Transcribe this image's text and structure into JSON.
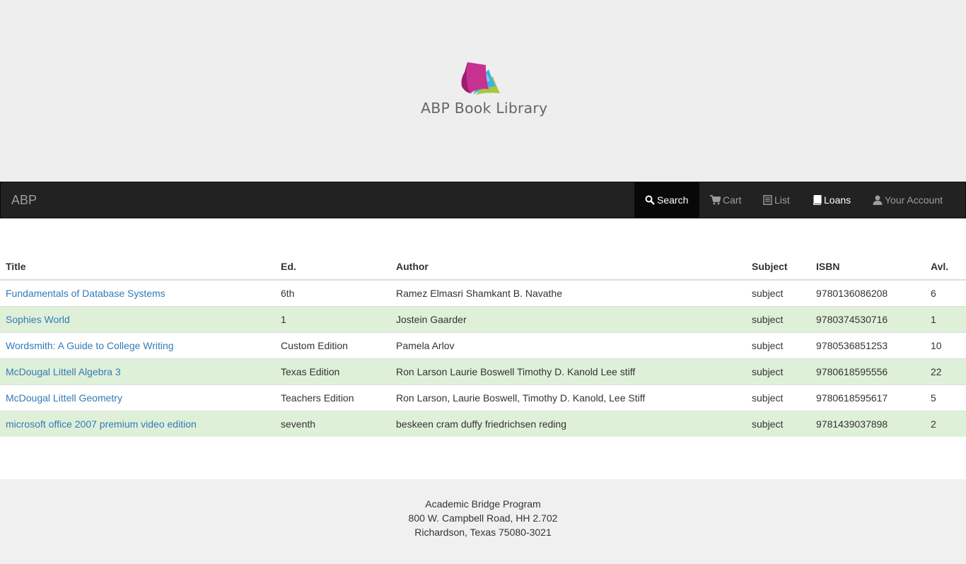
{
  "header": {
    "logo_text": "ABP Book Library"
  },
  "navbar": {
    "brand": "ABP",
    "items": [
      {
        "label": "Search",
        "icon": "search-icon",
        "active": true
      },
      {
        "label": "Cart",
        "icon": "cart-icon"
      },
      {
        "label": "List",
        "icon": "list-icon"
      },
      {
        "label": "Loans",
        "icon": "book-icon"
      },
      {
        "label": "Your Account",
        "icon": "user-icon"
      }
    ]
  },
  "table": {
    "columns": [
      "Title",
      "Ed.",
      "Author",
      "Subject",
      "ISBN",
      "Avl."
    ],
    "rows": [
      {
        "title": "Fundamentals of Database Systems",
        "ed": "6th",
        "author": "Ramez Elmasri Shamkant B. Navathe",
        "subject": "subject",
        "isbn": "9780136086208",
        "avl": "6"
      },
      {
        "title": "Sophies World",
        "ed": "1",
        "author": "Jostein Gaarder",
        "subject": "subject",
        "isbn": "9780374530716",
        "avl": "1"
      },
      {
        "title": "Wordsmith: A Guide to College Writing",
        "ed": "Custom Edition",
        "author": "Pamela Arlov",
        "subject": "subject",
        "isbn": "9780536851253",
        "avl": "10"
      },
      {
        "title": "McDougal Littell Algebra 3",
        "ed": "Texas Edition",
        "author": "Ron Larson Laurie Boswell Timothy D. Kanold Lee stiff",
        "subject": "subject",
        "isbn": "9780618595556",
        "avl": "22"
      },
      {
        "title": "McDougal Littell Geometry",
        "ed": "Teachers Edition",
        "author": "Ron Larson, Laurie Boswell, Timothy D. Kanold, Lee Stiff",
        "subject": "subject",
        "isbn": "9780618595617",
        "avl": "5"
      },
      {
        "title": "microsoft office 2007 premium video edition",
        "ed": "seventh",
        "author": "beskeen cram duffy friedrichsen reding",
        "subject": "subject",
        "isbn": "9781439037898",
        "avl": "2"
      }
    ]
  },
  "footer": {
    "line1": "Academic Bridge Program",
    "line2": "800 W. Campbell Road, HH 2.702",
    "line3": "Richardson, Texas 75080-3021"
  },
  "colors": {
    "navbar_bg": "#222222",
    "link": "#337ab7",
    "row_highlight": "#dff0d8",
    "logo_magenta": "#c7318f",
    "logo_blue": "#3bb3e4",
    "logo_green": "#a8c83a"
  }
}
